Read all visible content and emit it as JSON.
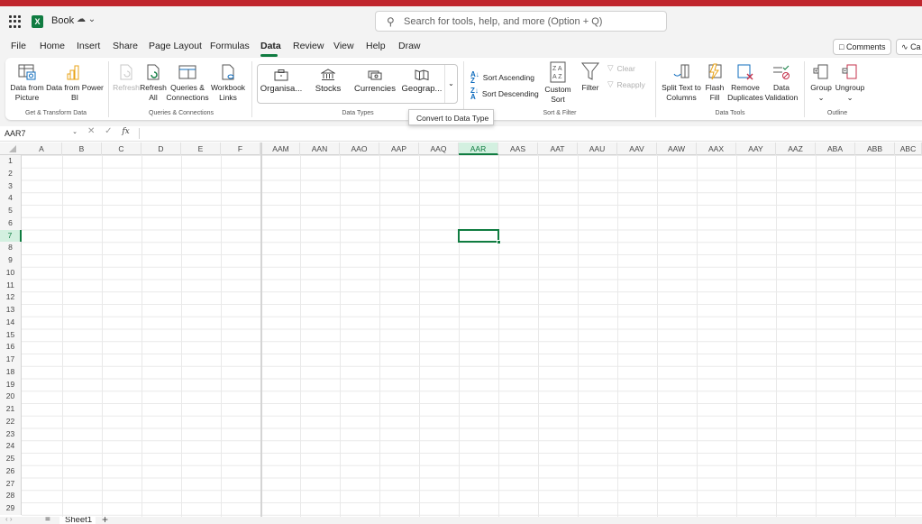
{
  "title_bar": {
    "app_name": "Book",
    "search_placeholder": "Search for tools, help, and more (Option + Q)"
  },
  "menu": [
    "File",
    "Home",
    "Insert",
    "Share",
    "Page Layout",
    "Formulas",
    "Data",
    "Review",
    "View",
    "Help",
    "Draw"
  ],
  "active_menu": "Data",
  "header_buttons": {
    "comments": "Comments",
    "catch_up": "Ca"
  },
  "ribbon": {
    "get_transform": {
      "data_from_picture": [
        "Data from",
        "Picture"
      ],
      "data_from_power_bi": [
        "Data from Power",
        "BI"
      ],
      "label": "Get & Transform Data"
    },
    "queries": {
      "refresh": "Refresh",
      "refresh_all": [
        "Refresh",
        "All"
      ],
      "queries_connections": [
        "Queries &",
        "Connections"
      ],
      "workbook_links": [
        "Workbook",
        "Links"
      ],
      "label": "Queries & Connections"
    },
    "data_types": {
      "items": [
        "Organisa...",
        "Stocks",
        "Currencies",
        "Geograp..."
      ],
      "label": "Data Types"
    },
    "sort_filter": {
      "sort_ascending": "Sort Ascending",
      "sort_descending": "Sort Descending",
      "custom_sort": [
        "Custom",
        "Sort"
      ],
      "filter": "Filter",
      "clear": "Clear",
      "reapply": "Reapply",
      "label": "Sort & Filter"
    },
    "data_tools": {
      "split_text": [
        "Split Text to",
        "Columns"
      ],
      "flash_fill": [
        "Flash",
        "Fill"
      ],
      "remove_duplicates": [
        "Remove",
        "Duplicates"
      ],
      "data_validation": [
        "Data",
        "Validation"
      ],
      "label": "Data Tools"
    },
    "outline": {
      "group": "Group",
      "ungroup": "Ungroup",
      "label": "Outline"
    }
  },
  "tooltip": "Convert to Data Type",
  "formula_bar": {
    "name_box": "AAR7",
    "fx": "fx"
  },
  "columns": [
    "A",
    "B",
    "C",
    "D",
    "E",
    "F",
    "AAM",
    "AAN",
    "AAO",
    "AAP",
    "AAQ",
    "AAR",
    "AAS",
    "AAT",
    "AAU",
    "AAV",
    "AAW",
    "AAX",
    "AAY",
    "AAZ",
    "ABA",
    "ABB",
    "ABC"
  ],
  "selected_column": "AAR",
  "rows": [
    "1",
    "2",
    "3",
    "4",
    "5",
    "6",
    "7",
    "8",
    "9",
    "10",
    "11",
    "12",
    "13",
    "14",
    "15",
    "16",
    "17",
    "18",
    "19",
    "20",
    "21",
    "22",
    "23",
    "24",
    "25",
    "26",
    "27",
    "28",
    "29"
  ],
  "selected_row": "7",
  "sheet_tabs": {
    "sheet1": "Sheet1",
    "add": "+"
  },
  "colors": {
    "accent": "#107c41",
    "top_strip": "#c0262d"
  }
}
